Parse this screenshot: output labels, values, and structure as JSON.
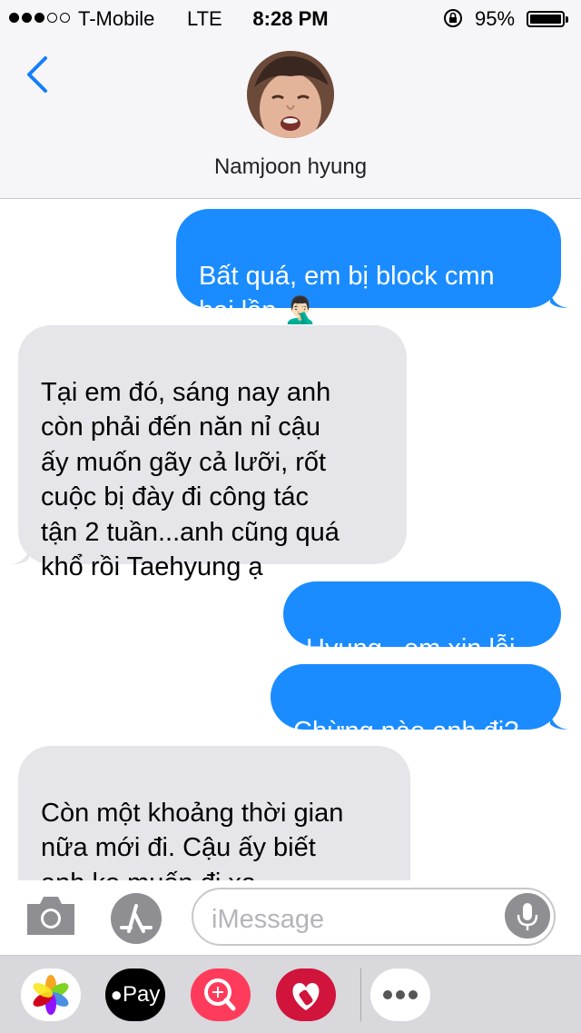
{
  "status_bar": {
    "carrier": "T-Mobile",
    "network": "LTE",
    "time": "8:28 PM",
    "battery_percent": "95%",
    "signal_bars_filled": 3,
    "signal_bars_total": 5
  },
  "header": {
    "contact_name": "Namjoon hyung"
  },
  "messages": [
    {
      "direction": "sent",
      "text": "Bất quá, em bị block cmn\nhai lần 🤦🏻‍♂️"
    },
    {
      "direction": "received",
      "text": "Tại em đó, sáng nay anh\ncòn phải đến năn nỉ cậu\nấy muốn gãy cả lưỡi, rốt\ncuộc bị đày đi công tác\ntận 2 tuần...anh cũng quá\nkhổ rồi Taehyung ạ"
    },
    {
      "direction": "sent",
      "text": "Hyung...em xin lỗi"
    },
    {
      "direction": "sent",
      "text": "Chừng nào anh đi?"
    },
    {
      "direction": "received",
      "text": "Còn một khoảng thời gian\nnữa mới đi. Cậu ấy biết\nanh ko muốn đi xa\nSeokjin, cho nên mới kiếm"
    }
  ],
  "compose": {
    "placeholder": "iMessage"
  },
  "app_drawer": {
    "apple_pay_label": "Pay"
  },
  "colors": {
    "sent_bubble": "#1a8cff",
    "received_bubble": "#e5e5ea",
    "accent": "#147efb"
  }
}
